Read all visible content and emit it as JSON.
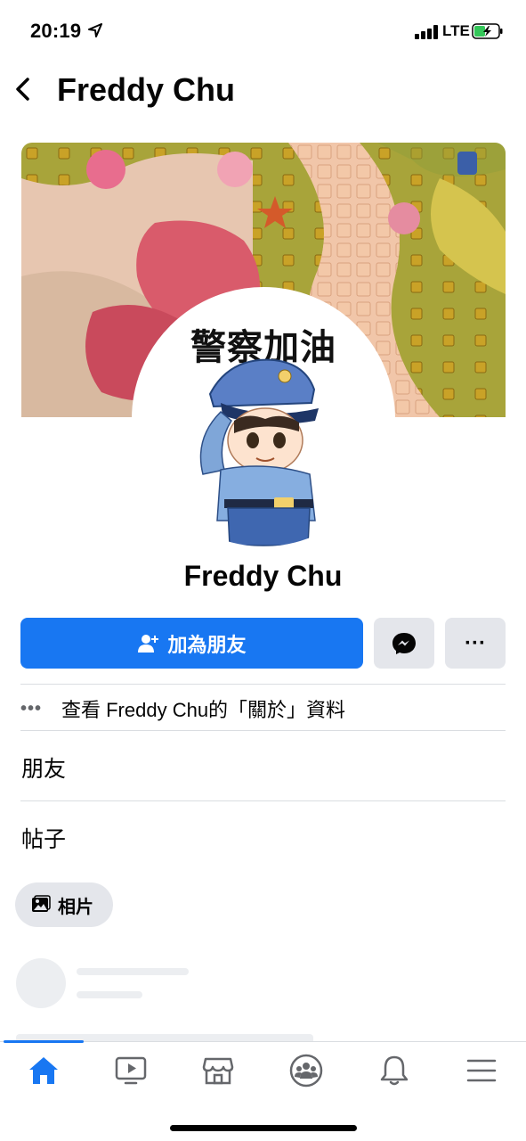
{
  "status_bar": {
    "time": "20:19",
    "network": "LTE"
  },
  "header": {
    "title": "Freddy Chu"
  },
  "profile": {
    "picture_caption": "警察加油",
    "name": "Freddy Chu"
  },
  "actions": {
    "add_friend_label": "加為朋友",
    "more_label": "···"
  },
  "about": {
    "dots": "•••",
    "text": "查看 Freddy Chu的「關於」資料"
  },
  "sections": {
    "friends_title": "朋友",
    "posts_title": "帖子"
  },
  "filter_chip": {
    "photos_label": "相片"
  },
  "tabbar": {
    "active": "home",
    "tabs": [
      "home-icon",
      "watch-icon",
      "marketplace-icon",
      "groups-icon",
      "notifications-icon",
      "menu-icon"
    ]
  },
  "colors": {
    "accent": "#1877f2",
    "button_gray": "#e4e6eb",
    "text": "#050505",
    "secondary_text": "#65676b"
  }
}
